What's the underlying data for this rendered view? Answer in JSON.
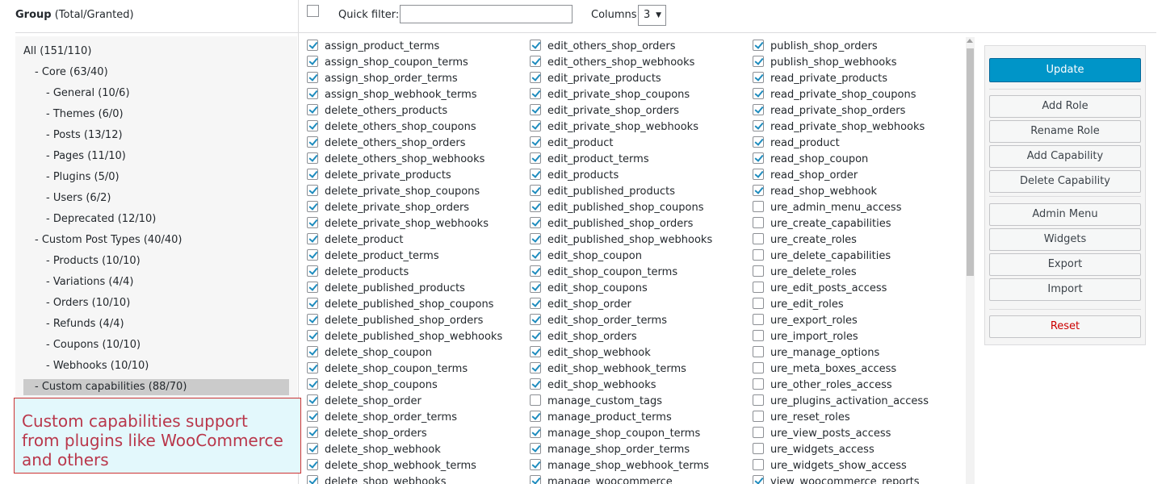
{
  "header": {
    "group_label": "Group",
    "group_suffix": "(Total/Granted)"
  },
  "groups": [
    {
      "label": "All (151/110)",
      "selected": false
    },
    {
      "label": "- Core (63/40)",
      "selected": false
    },
    {
      "label": "- General (10/6)",
      "selected": false
    },
    {
      "label": "- Themes (6/0)",
      "selected": false
    },
    {
      "label": "- Posts (13/12)",
      "selected": false
    },
    {
      "label": "- Pages (11/10)",
      "selected": false
    },
    {
      "label": "- Plugins (5/0)",
      "selected": false
    },
    {
      "label": "- Users (6/2)",
      "selected": false
    },
    {
      "label": "- Deprecated (12/10)",
      "selected": false
    },
    {
      "label": "- Custom Post Types (40/40)",
      "selected": false
    },
    {
      "label": "- Products (10/10)",
      "selected": false
    },
    {
      "label": "- Variations (4/4)",
      "selected": false
    },
    {
      "label": "- Orders (10/10)",
      "selected": false
    },
    {
      "label": "- Refunds (4/4)",
      "selected": false
    },
    {
      "label": "- Coupons (10/10)",
      "selected": false
    },
    {
      "label": "- Webhooks (10/10)",
      "selected": false
    },
    {
      "label": "- Custom capabilities (88/70)",
      "selected": true
    }
  ],
  "callout": {
    "line1": "Custom capabilities support",
    "line2": "from plugins like WooCommerce",
    "line3": "and others"
  },
  "toolbar": {
    "quick_filter_label": "Quick filter:",
    "quick_filter_value": "",
    "columns_label": "Columns:",
    "columns_value": "3"
  },
  "capabilities": [
    [
      {
        "name": "assign_product_terms",
        "checked": true
      },
      {
        "name": "assign_shop_coupon_terms",
        "checked": true
      },
      {
        "name": "assign_shop_order_terms",
        "checked": true
      },
      {
        "name": "assign_shop_webhook_terms",
        "checked": true
      },
      {
        "name": "delete_others_products",
        "checked": true
      },
      {
        "name": "delete_others_shop_coupons",
        "checked": true
      },
      {
        "name": "delete_others_shop_orders",
        "checked": true
      },
      {
        "name": "delete_others_shop_webhooks",
        "checked": true
      },
      {
        "name": "delete_private_products",
        "checked": true
      },
      {
        "name": "delete_private_shop_coupons",
        "checked": true
      },
      {
        "name": "delete_private_shop_orders",
        "checked": true
      },
      {
        "name": "delete_private_shop_webhooks",
        "checked": true
      },
      {
        "name": "delete_product",
        "checked": true
      },
      {
        "name": "delete_product_terms",
        "checked": true
      },
      {
        "name": "delete_products",
        "checked": true
      },
      {
        "name": "delete_published_products",
        "checked": true
      },
      {
        "name": "delete_published_shop_coupons",
        "checked": true
      },
      {
        "name": "delete_published_shop_orders",
        "checked": true
      },
      {
        "name": "delete_published_shop_webhooks",
        "checked": true
      },
      {
        "name": "delete_shop_coupon",
        "checked": true
      },
      {
        "name": "delete_shop_coupon_terms",
        "checked": true
      },
      {
        "name": "delete_shop_coupons",
        "checked": true
      },
      {
        "name": "delete_shop_order",
        "checked": true
      },
      {
        "name": "delete_shop_order_terms",
        "checked": true
      },
      {
        "name": "delete_shop_orders",
        "checked": true
      },
      {
        "name": "delete_shop_webhook",
        "checked": true
      },
      {
        "name": "delete_shop_webhook_terms",
        "checked": true
      },
      {
        "name": "delete_shop_webhooks",
        "checked": true
      }
    ],
    [
      {
        "name": "edit_others_shop_orders",
        "checked": true
      },
      {
        "name": "edit_others_shop_webhooks",
        "checked": true
      },
      {
        "name": "edit_private_products",
        "checked": true
      },
      {
        "name": "edit_private_shop_coupons",
        "checked": true
      },
      {
        "name": "edit_private_shop_orders",
        "checked": true
      },
      {
        "name": "edit_private_shop_webhooks",
        "checked": true
      },
      {
        "name": "edit_product",
        "checked": true
      },
      {
        "name": "edit_product_terms",
        "checked": true
      },
      {
        "name": "edit_products",
        "checked": true
      },
      {
        "name": "edit_published_products",
        "checked": true
      },
      {
        "name": "edit_published_shop_coupons",
        "checked": true
      },
      {
        "name": "edit_published_shop_orders",
        "checked": true
      },
      {
        "name": "edit_published_shop_webhooks",
        "checked": true
      },
      {
        "name": "edit_shop_coupon",
        "checked": true
      },
      {
        "name": "edit_shop_coupon_terms",
        "checked": true
      },
      {
        "name": "edit_shop_coupons",
        "checked": true
      },
      {
        "name": "edit_shop_order",
        "checked": true
      },
      {
        "name": "edit_shop_order_terms",
        "checked": true
      },
      {
        "name": "edit_shop_orders",
        "checked": true
      },
      {
        "name": "edit_shop_webhook",
        "checked": true
      },
      {
        "name": "edit_shop_webhook_terms",
        "checked": true
      },
      {
        "name": "edit_shop_webhooks",
        "checked": true
      },
      {
        "name": "manage_custom_tags",
        "checked": false
      },
      {
        "name": "manage_product_terms",
        "checked": true
      },
      {
        "name": "manage_shop_coupon_terms",
        "checked": true
      },
      {
        "name": "manage_shop_order_terms",
        "checked": true
      },
      {
        "name": "manage_shop_webhook_terms",
        "checked": true
      },
      {
        "name": "manage_woocommerce",
        "checked": true
      }
    ],
    [
      {
        "name": "publish_shop_orders",
        "checked": true
      },
      {
        "name": "publish_shop_webhooks",
        "checked": true
      },
      {
        "name": "read_private_products",
        "checked": true
      },
      {
        "name": "read_private_shop_coupons",
        "checked": true
      },
      {
        "name": "read_private_shop_orders",
        "checked": true
      },
      {
        "name": "read_private_shop_webhooks",
        "checked": true
      },
      {
        "name": "read_product",
        "checked": true
      },
      {
        "name": "read_shop_coupon",
        "checked": true
      },
      {
        "name": "read_shop_order",
        "checked": true
      },
      {
        "name": "read_shop_webhook",
        "checked": true
      },
      {
        "name": "ure_admin_menu_access",
        "checked": false
      },
      {
        "name": "ure_create_capabilities",
        "checked": false
      },
      {
        "name": "ure_create_roles",
        "checked": false
      },
      {
        "name": "ure_delete_capabilities",
        "checked": false
      },
      {
        "name": "ure_delete_roles",
        "checked": false
      },
      {
        "name": "ure_edit_posts_access",
        "checked": false
      },
      {
        "name": "ure_edit_roles",
        "checked": false
      },
      {
        "name": "ure_export_roles",
        "checked": false
      },
      {
        "name": "ure_import_roles",
        "checked": false
      },
      {
        "name": "ure_manage_options",
        "checked": false
      },
      {
        "name": "ure_meta_boxes_access",
        "checked": false
      },
      {
        "name": "ure_other_roles_access",
        "checked": false
      },
      {
        "name": "ure_plugins_activation_access",
        "checked": false
      },
      {
        "name": "ure_reset_roles",
        "checked": false
      },
      {
        "name": "ure_view_posts_access",
        "checked": false
      },
      {
        "name": "ure_widgets_access",
        "checked": false
      },
      {
        "name": "ure_widgets_show_access",
        "checked": false
      },
      {
        "name": "view_woocommerce_reports",
        "checked": true
      }
    ]
  ],
  "buttons": {
    "update": "Update",
    "add_role": "Add Role",
    "rename_role": "Rename Role",
    "add_capability": "Add Capability",
    "delete_capability": "Delete Capability",
    "admin_menu": "Admin Menu",
    "widgets": "Widgets",
    "export": "Export",
    "import": "Import",
    "reset": "Reset"
  },
  "colors": {
    "primary_button": "#0095c8",
    "checkmark": "#1e8cbe",
    "reset_text": "#cc0000",
    "callout_text": "#b9374b",
    "callout_bg": "#e3f8fc"
  }
}
